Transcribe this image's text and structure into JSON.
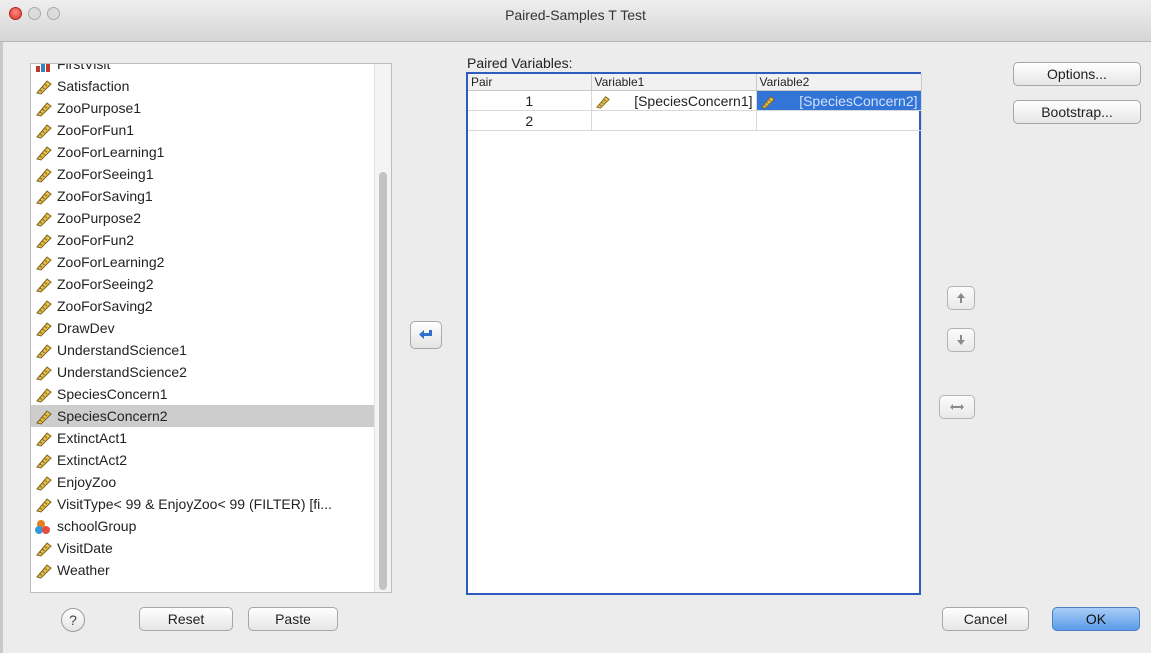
{
  "window": {
    "title": "Paired-Samples T Test"
  },
  "variables": [
    {
      "name": "FirstVisit",
      "icon": "bar-chart-icon"
    },
    {
      "name": "Satisfaction",
      "icon": "ruler-icon"
    },
    {
      "name": "ZooPurpose1",
      "icon": "ruler-icon"
    },
    {
      "name": "ZooForFun1",
      "icon": "ruler-icon"
    },
    {
      "name": "ZooForLearning1",
      "icon": "ruler-icon"
    },
    {
      "name": "ZooForSeeing1",
      "icon": "ruler-icon"
    },
    {
      "name": "ZooForSaving1",
      "icon": "ruler-icon"
    },
    {
      "name": "ZooPurpose2",
      "icon": "ruler-icon"
    },
    {
      "name": "ZooForFun2",
      "icon": "ruler-icon"
    },
    {
      "name": "ZooForLearning2",
      "icon": "ruler-icon"
    },
    {
      "name": "ZooForSeeing2",
      "icon": "ruler-icon"
    },
    {
      "name": "ZooForSaving2",
      "icon": "ruler-icon"
    },
    {
      "name": "DrawDev",
      "icon": "ruler-icon"
    },
    {
      "name": "UnderstandScience1",
      "icon": "ruler-icon"
    },
    {
      "name": "UnderstandScience2",
      "icon": "ruler-icon"
    },
    {
      "name": "SpeciesConcern1",
      "icon": "ruler-icon"
    },
    {
      "name": "SpeciesConcern2",
      "icon": "ruler-icon",
      "selected": true
    },
    {
      "name": "ExtinctAct1",
      "icon": "ruler-icon"
    },
    {
      "name": "ExtinctAct2",
      "icon": "ruler-icon"
    },
    {
      "name": "EnjoyZoo",
      "icon": "ruler-icon"
    },
    {
      "name": "VisitType< 99 & EnjoyZoo< 99 (FILTER) [fi...",
      "icon": "ruler-icon"
    },
    {
      "name": "schoolGroup",
      "icon": "nominal-icon"
    },
    {
      "name": "VisitDate",
      "icon": "ruler-icon"
    },
    {
      "name": "Weather",
      "icon": "ruler-icon"
    }
  ],
  "paired": {
    "label": "Paired Variables:",
    "headers": {
      "pair": "Pair",
      "var1": "Variable1",
      "var2": "Variable2"
    },
    "rows": [
      {
        "pair": "1",
        "var1": "[SpeciesConcern1]",
        "var2": "[SpeciesConcern2]"
      },
      {
        "pair": "2",
        "var1": "",
        "var2": ""
      }
    ]
  },
  "buttons": {
    "options": "Options...",
    "bootstrap": "Bootstrap...",
    "help": "?",
    "reset": "Reset",
    "paste": "Paste",
    "cancel": "Cancel",
    "ok": "OK"
  }
}
